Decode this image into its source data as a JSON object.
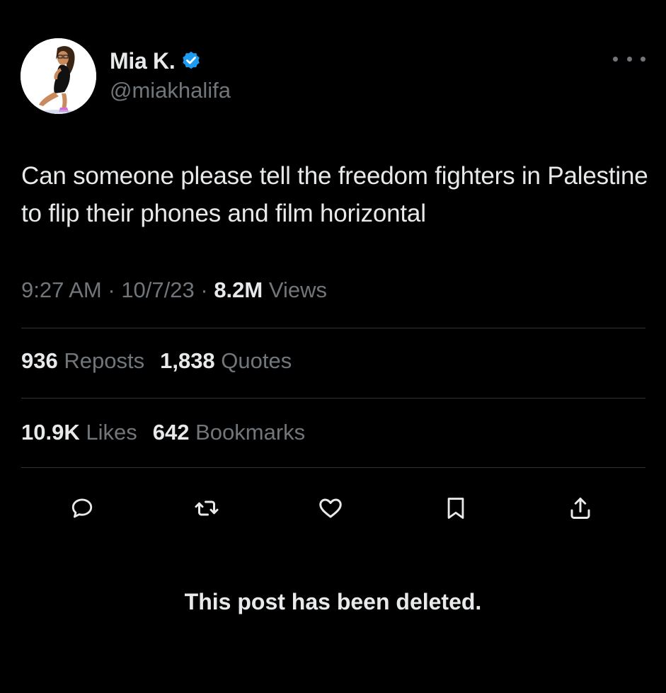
{
  "author": {
    "display_name": "Mia K.",
    "handle": "@miakhalifa",
    "verified": true,
    "verified_color": "#1d9bf0"
  },
  "tweet": {
    "text": "Can someone please tell the freedom fighters in Palestine to flip their phones and film horizontal",
    "time": "9:27 AM",
    "date": "10/7/23",
    "views_count": "8.2M",
    "views_label": "Views"
  },
  "stats": {
    "reposts_count": "936",
    "reposts_label": "Reposts",
    "quotes_count": "1,838",
    "quotes_label": "Quotes",
    "likes_count": "10.9K",
    "likes_label": "Likes",
    "bookmarks_count": "642",
    "bookmarks_label": "Bookmarks"
  },
  "actions": [
    {
      "name": "reply",
      "icon": "reply-icon"
    },
    {
      "name": "repost",
      "icon": "repost-icon"
    },
    {
      "name": "like",
      "icon": "heart-icon"
    },
    {
      "name": "bookmark",
      "icon": "bookmark-icon"
    },
    {
      "name": "share",
      "icon": "share-icon"
    }
  ],
  "notice": "This post has been deleted.",
  "colors": {
    "background": "#000000",
    "primary_text": "#e7e9ea",
    "secondary_text": "#71767b",
    "divider": "#2f3336"
  }
}
